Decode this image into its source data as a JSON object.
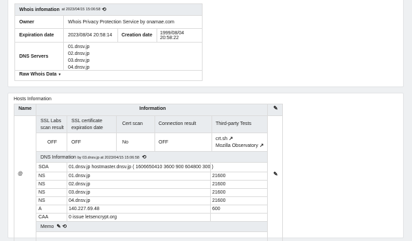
{
  "whois": {
    "title": "Whois infomation",
    "timestamp": "at 2023/04/15 15:06:58",
    "owner_label": "Owner",
    "owner_value": "Whois Privacy Protection Service by onamae.com",
    "expiration_label": "Expiration date",
    "expiration_value": "2023/08/04 20:58:14",
    "creation_label": "Creation date",
    "creation_value": "1999/08/04 20:58:22",
    "dns_label": "DNS Servers",
    "dns_servers": [
      "01.dnsv.jp",
      "02.dnsv.jp",
      "03.dnsv.jp",
      "04.dnsv.jp"
    ],
    "raw_label": "Raw Whois Data"
  },
  "hosts": {
    "section_title": "Hosts Information",
    "col_name": "Name",
    "col_info": "Information",
    "host_name": "@",
    "ssl": {
      "headers": [
        "SSL Labs scan result",
        "SSL certificate expiration date",
        "Cert scan",
        "Connection result",
        "Third-party Tests"
      ],
      "values": [
        "OFF",
        "OFF",
        "No",
        "OFF"
      ],
      "third_party": [
        "crt.sh",
        "Mozilla Observatory"
      ]
    },
    "dns": {
      "title": "DNS Information",
      "timestamp": "by 03.dnsv.jp at 2023/04/15 15:06:58",
      "records": [
        {
          "type": "SOA",
          "value": "01.dnsv.jp hostmaster.dnsv.jp ( 1606650410 3600 900 604800 300 )",
          "ttl": ""
        },
        {
          "type": "NS",
          "value": "01.dnsv.jp",
          "ttl": "21600"
        },
        {
          "type": "NS",
          "value": "02.dnsv.jp",
          "ttl": "21600"
        },
        {
          "type": "NS",
          "value": "03.dnsv.jp",
          "ttl": "21600"
        },
        {
          "type": "NS",
          "value": "04.dnsv.jp",
          "ttl": "21600"
        },
        {
          "type": "A",
          "value": "140.227.69.48",
          "ttl": "600"
        },
        {
          "type": "CAA",
          "value": "0 issue letsencrypt.org",
          "ttl": ""
        }
      ]
    },
    "memo_label": "Memo"
  },
  "icons": {
    "edit": "edit-icon",
    "history": "history-icon",
    "external": "external-link-icon",
    "caret": "caret-down-icon"
  }
}
